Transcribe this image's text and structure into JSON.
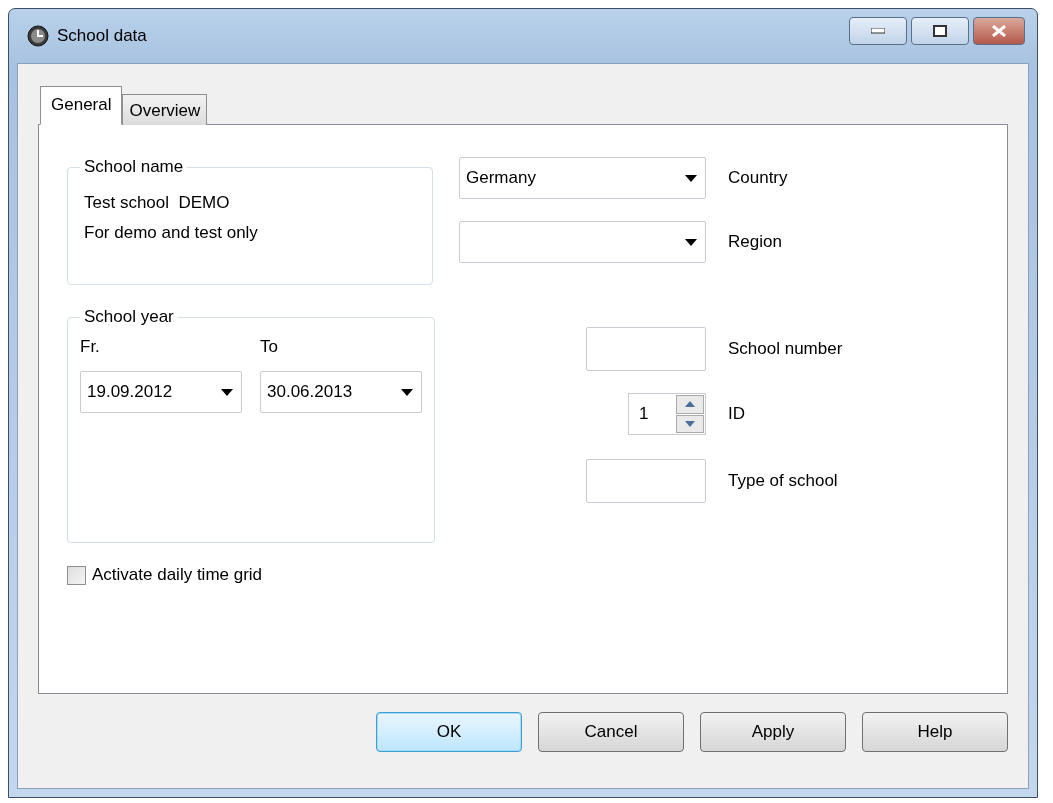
{
  "window": {
    "title": "School data"
  },
  "tabs": [
    {
      "label": "General",
      "selected": true
    },
    {
      "label": "Overview",
      "selected": false
    }
  ],
  "school_name": {
    "title": "School name",
    "lines": [
      "Test school  DEMO",
      "For demo and test only"
    ]
  },
  "school_year": {
    "title": "School year",
    "from": {
      "label": "Fr.",
      "value": "19.09.2012"
    },
    "to": {
      "label": "To",
      "value": "30.06.2013"
    }
  },
  "daily_grid": {
    "label": "Activate daily time grid",
    "checked": false
  },
  "fields": [
    {
      "kind": "combo",
      "value": "Germany",
      "label": "Country"
    },
    {
      "kind": "combo",
      "label": "Region"
    },
    {
      "kind": "text",
      "label": "School number"
    },
    {
      "kind": "spin",
      "value": "1",
      "label": "ID"
    },
    {
      "kind": "text",
      "label": "Type of school"
    }
  ],
  "buttons": [
    {
      "label": "OK",
      "default": true
    },
    {
      "label": "Cancel",
      "default": false
    },
    {
      "label": "Apply",
      "default": false
    },
    {
      "label": "Help",
      "default": false
    }
  ]
}
